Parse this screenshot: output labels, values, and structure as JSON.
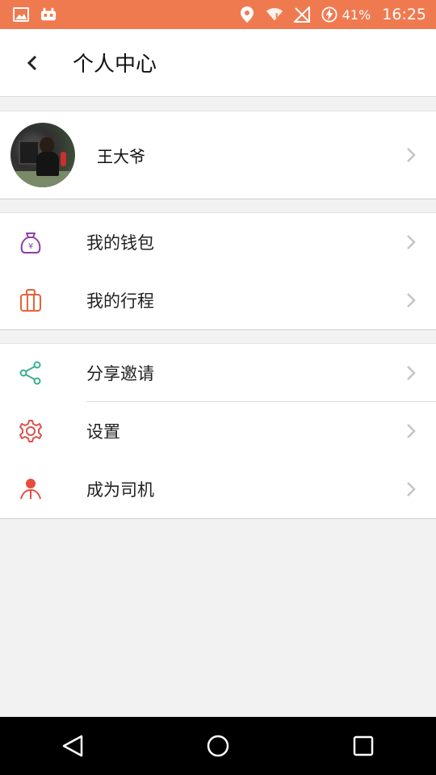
{
  "status_bar": {
    "battery": "41%",
    "time": "16:25"
  },
  "header": {
    "title": "个人中心"
  },
  "profile": {
    "name": "王大爷"
  },
  "menu_group_1": [
    {
      "label": "我的钱包",
      "icon": "wallet-icon",
      "color": "#8e3ea8"
    },
    {
      "label": "我的行程",
      "icon": "luggage-icon",
      "color": "#e8633a"
    }
  ],
  "menu_group_2": [
    {
      "label": "分享邀请",
      "icon": "share-icon",
      "color": "#3bb08f"
    },
    {
      "label": "设置",
      "icon": "gear-icon",
      "color": "#d9534f"
    },
    {
      "label": "成为司机",
      "icon": "driver-icon",
      "color": "#e84c3d"
    }
  ],
  "colors": {
    "status_bar": "#f07a50",
    "background": "#f2f2f2"
  }
}
